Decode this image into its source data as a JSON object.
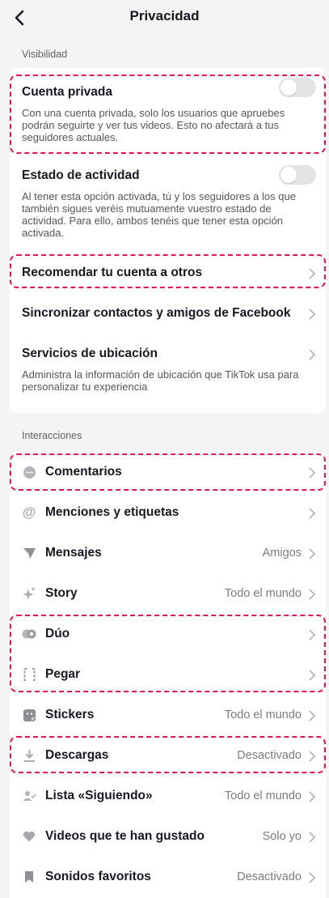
{
  "header": {
    "title": "Privacidad"
  },
  "sections": {
    "visibilidad": "Visibilidad",
    "interacciones": "Interacciones"
  },
  "visibility": {
    "private_account": {
      "title": "Cuenta privada",
      "desc": "Con una cuenta privada, solo los usuarios que apruebes podrán seguirte y ver tus videos. Esto no afectará a tus seguidores actuales.",
      "enabled": false
    },
    "activity_status": {
      "title": "Estado de actividad",
      "desc": "Al tener esta opción activada, tú y los seguidores a los que también sigues veréis mutuamente vuestro estado de actividad. Para ello, ambos tenéis que tener esta opción activada.",
      "enabled": false
    },
    "suggest_account": {
      "title": "Recomendar tu cuenta a otros"
    },
    "sync_contacts": {
      "title": "Sincronizar contactos y amigos de Facebook"
    },
    "location": {
      "title": "Servicios de ubicación",
      "desc": "Administra la información de ubicación que TikTok usa para personalizar tu experiencia"
    }
  },
  "interactions": [
    {
      "icon": "comment-icon",
      "label": "Comentarios",
      "value": ""
    },
    {
      "icon": "at-mention-icon",
      "label": "Menciones y etiquetas",
      "value": ""
    },
    {
      "icon": "direct-message-icon",
      "label": "Mensajes",
      "value": "Amigos"
    },
    {
      "icon": "story-sparkle-icon",
      "label": "Story",
      "value": "Todo el mundo"
    },
    {
      "icon": "duet-icon",
      "label": "Dúo",
      "value": ""
    },
    {
      "icon": "stitch-icon",
      "label": "Pegar",
      "value": ""
    },
    {
      "icon": "sticker-icon",
      "label": "Stickers",
      "value": "Todo el mundo"
    },
    {
      "icon": "download-icon",
      "label": "Descargas",
      "value": "Desactivado"
    },
    {
      "icon": "following-list-icon",
      "label": "Lista «Siguiendo»",
      "value": "Todo el mundo"
    },
    {
      "icon": "heart-icon",
      "label": "Videos que te han gustado",
      "value": "Solo yo"
    },
    {
      "icon": "bookmark-icon",
      "label": "Sonidos favoritos",
      "value": "Desactivado"
    }
  ],
  "colors": {
    "highlight": "#e2125a",
    "background": "#f4f4f5",
    "card": "#ffffff",
    "text": "#161823",
    "secondary_text": "#7b7c82"
  }
}
